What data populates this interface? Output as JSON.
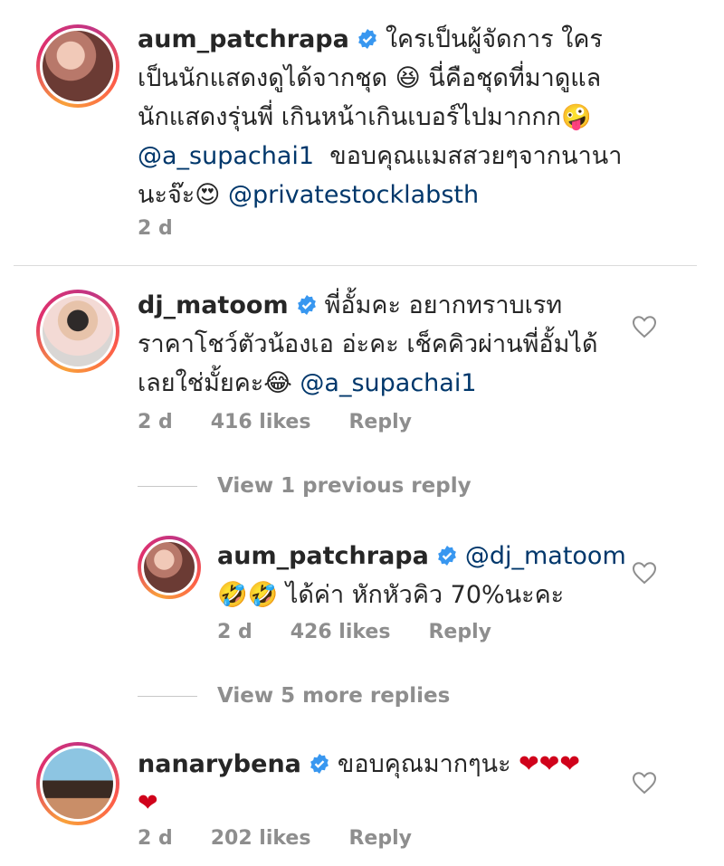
{
  "comments": [
    {
      "username": "aum_patchrapa",
      "text_1": "ใครเป็นผู้จัดการ ใคร",
      "text_2": "เป็นนักแสดงดูได้จากชุด 😆 นี่คือชุดที่มาดูแล",
      "text_3": "นักแสดงรุ่นพี่ เกินหน้าเกินเบอร์ไปมากกก🤪",
      "mention_1": "@a_supachai1",
      "text_4": "  ขอบคุณแมสสวยๆจากนานา",
      "text_5": "นะจ๊ะ😍 ",
      "mention_2": "@privatestocklabsth",
      "time": "2 d"
    },
    {
      "username": "dj_matoom",
      "text_1": "พี่อั้มคะ อยากทราบเรท",
      "text_2": "ราคาโชว์ตัวน้องเอ อ่ะคะ เช็คคิวผ่านพี่อั้มได้",
      "text_3": "เลยใช่มั้ยคะ😂 ",
      "mention_1": "@a_supachai1",
      "time": "2 d",
      "likes": "416 likes",
      "reply": "Reply"
    },
    {
      "username": "aum_patchrapa",
      "mention_1": "@dj_matoom",
      "text_2": "🤣🤣 ได้ค่า หักหัวคิว 70%นะคะ",
      "time": "2 d",
      "likes": "426 likes",
      "reply": "Reply"
    },
    {
      "username": "nanarybena",
      "text_1": "ขอบคุณมากๆนะ ",
      "hearts_1": "❤❤❤",
      "hearts_2": "❤",
      "time": "2 d",
      "likes": "202 likes",
      "reply": "Reply"
    }
  ],
  "view_previous": "View 1 previous reply",
  "view_more": "View 5 more replies",
  "colors": {
    "mention": "#00376b",
    "meta": "#8e8e8e",
    "verified": "#3897f0"
  }
}
